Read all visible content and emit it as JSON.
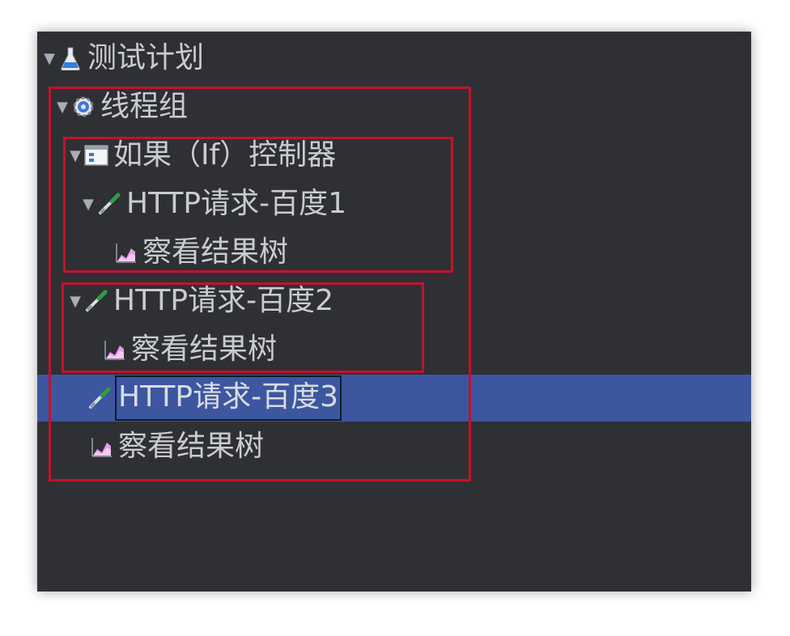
{
  "tree": {
    "nodes": [
      {
        "label": "测试计划",
        "icon": "test-plan-flask-icon",
        "expanded": true
      },
      {
        "label": "线程组",
        "icon": "thread-group-gear-icon",
        "expanded": true
      },
      {
        "label": "如果（If）控制器",
        "icon": "if-controller-icon",
        "expanded": true
      },
      {
        "label": "HTTP请求-百度1",
        "icon": "http-sampler-pipette-icon",
        "expanded": true
      },
      {
        "label": "察看结果树",
        "icon": "view-results-tree-icon"
      },
      {
        "label": "HTTP请求-百度2",
        "icon": "http-sampler-pipette-icon",
        "expanded": true
      },
      {
        "label": "察看结果树",
        "icon": "view-results-tree-icon"
      },
      {
        "label": "HTTP请求-百度3",
        "icon": "http-sampler-pipette-icon",
        "selected": true
      },
      {
        "label": "察看结果树",
        "icon": "view-results-tree-icon"
      }
    ]
  },
  "colors": {
    "panel_bg": "#2f3033",
    "selection_bg": "#3d56a0",
    "annotation_red": "#c4122a",
    "text": "#c8ccd2"
  }
}
